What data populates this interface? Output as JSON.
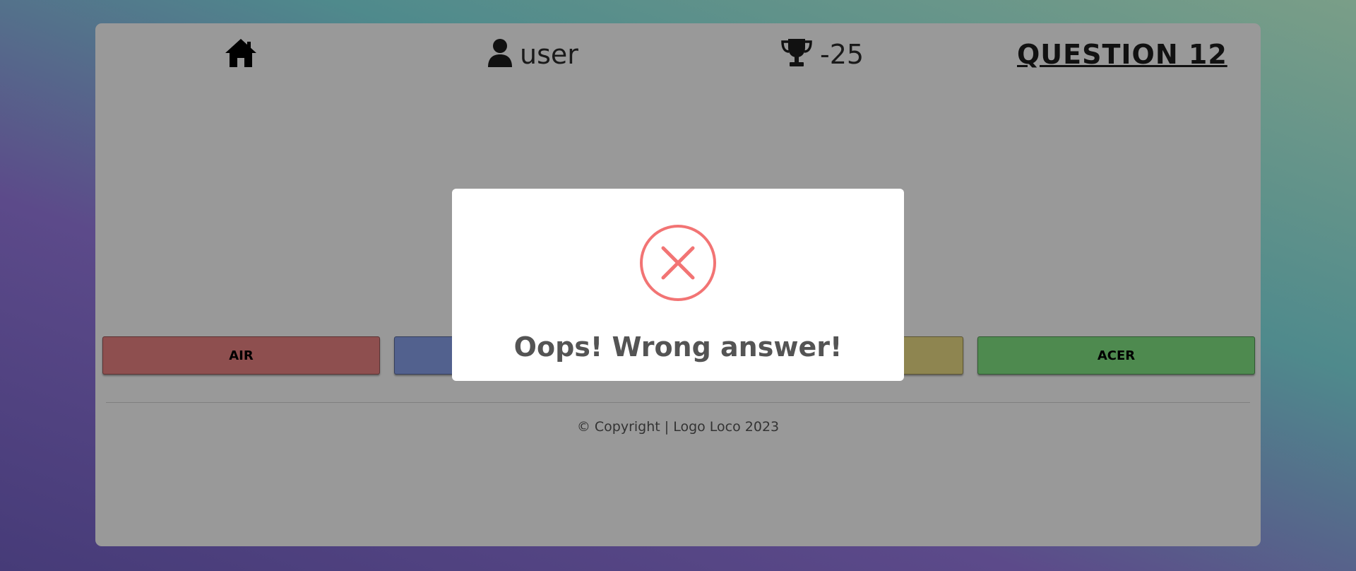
{
  "header": {
    "home_icon": "home-icon",
    "user_icon": "user-icon",
    "username": "user",
    "trophy_icon": "trophy-icon",
    "score": "-25",
    "question_label": "QUESTION 12"
  },
  "answers": [
    {
      "label": "AIR",
      "color": "#8e4f4f"
    },
    {
      "label": "",
      "color": "#52618e"
    },
    {
      "label": "",
      "color": "#8e8550"
    },
    {
      "label": "ACER",
      "color": "#4e8a4f"
    }
  ],
  "footer": {
    "copyright": "© Copyright | Logo Loco 2023"
  },
  "modal": {
    "icon": "error-x-icon",
    "icon_color": "#f27474",
    "message": "Oops! Wrong answer!"
  },
  "colors": {
    "overlay_card": "#999999",
    "modal_bg": "#ffffff"
  }
}
